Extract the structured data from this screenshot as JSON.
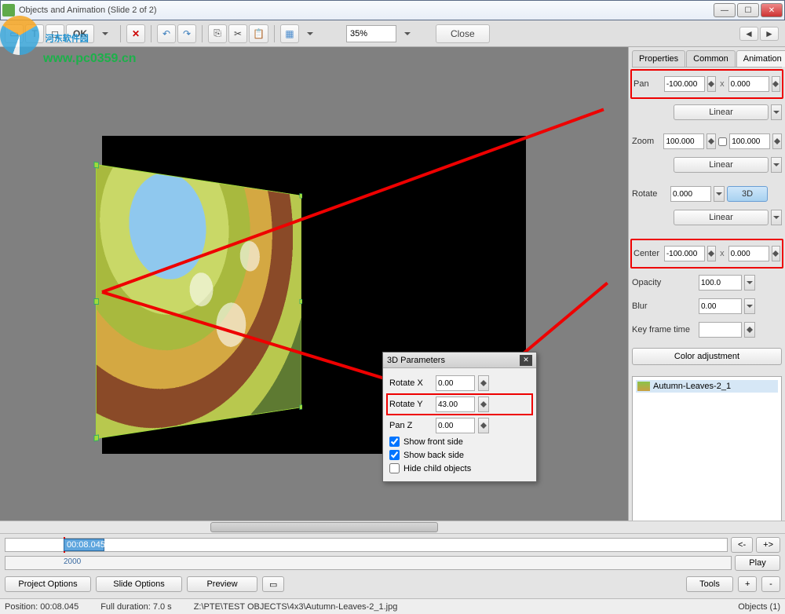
{
  "window": {
    "title": "Objects and Animation  (Slide 2 of 2)",
    "minimize": "—",
    "maximize": "☐",
    "close": "✕"
  },
  "watermark": {
    "line1": "河东软件园",
    "line2": "www.pc0359.cn"
  },
  "toolbar": {
    "ok": "OK",
    "text_tool": "T",
    "delete": "✕",
    "undo": "↶",
    "redo": "↷",
    "copy": "⎘",
    "cut": "✂",
    "paste": "📋",
    "grid": "▦",
    "zoom": "35%",
    "close": "Close",
    "prev": "◄",
    "next": "►"
  },
  "tabs": {
    "properties": "Properties",
    "common": "Common",
    "animation": "Animation"
  },
  "props": {
    "pan_label": "Pan",
    "pan_x": "-100.000",
    "pan_y": "0.000",
    "linear": "Linear",
    "zoom_label": "Zoom",
    "zoom_x": "100.000",
    "zoom_y": "100.000",
    "rotate_label": "Rotate",
    "rotate_val": "0.000",
    "btn3d": "3D",
    "center_label": "Center",
    "center_x": "-100.000",
    "center_y": "0.000",
    "opacity_label": "Opacity",
    "opacity_val": "100.0",
    "blur_label": "Blur",
    "blur_val": "0.00",
    "kft_label": "Key frame time",
    "kft_val": "",
    "coloradj": "Color adjustment",
    "x": "x"
  },
  "object_tree": {
    "item1": "Autumn-Leaves-2_1"
  },
  "dialog3d": {
    "title": "3D Parameters",
    "rotx_label": "Rotate X",
    "rotx": "0.00",
    "roty_label": "Rotate Y",
    "roty": "43.00",
    "panz_label": "Pan Z",
    "panz": "0.00",
    "show_front": "Show front side",
    "show_back": "Show back side",
    "hide_child": "Hide child objects"
  },
  "timeline": {
    "kf_time": "00:08.045",
    "marker": "2000"
  },
  "nav": {
    "prev_kf": "<-",
    "next_kf": "+>",
    "play": "Play"
  },
  "buttons": {
    "project_options": "Project Options",
    "slide_options": "Slide Options",
    "preview": "Preview",
    "tools": "Tools",
    "plus": "+",
    "minus": "-"
  },
  "status": {
    "position": "Position: 00:08.045",
    "duration": "Full duration: 7.0 s",
    "path": "Z:\\PTE\\TEST OBJECTS\\4x3\\Autumn-Leaves-2_1.jpg",
    "objects": "Objects (1)"
  }
}
